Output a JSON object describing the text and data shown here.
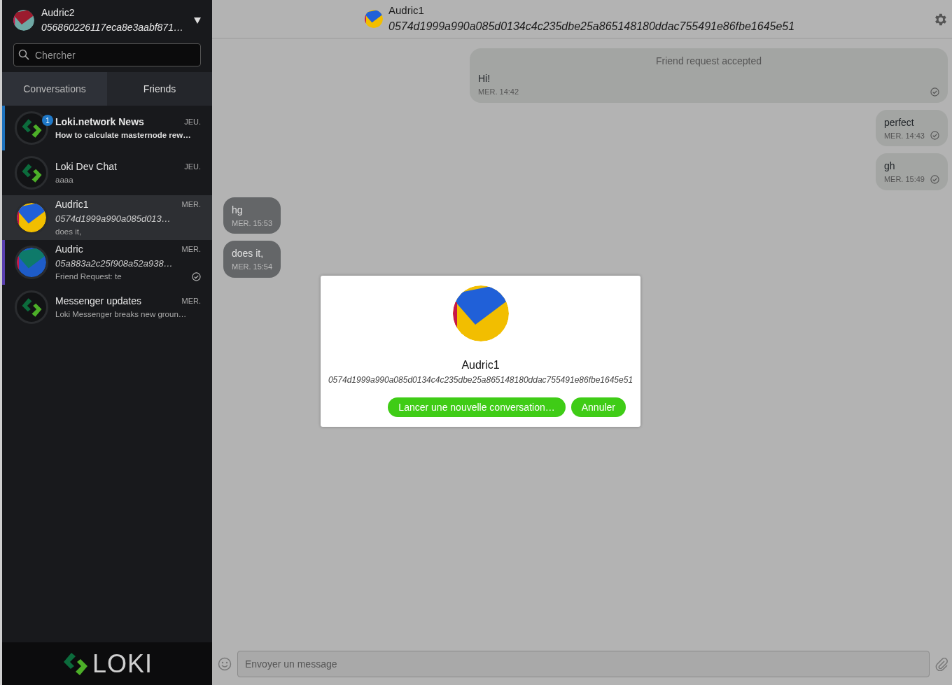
{
  "profile": {
    "name": "Audric2",
    "pubkey": "056860226117eca8e3aabf871…",
    "avatar": {
      "kind": "identicon"
    }
  },
  "search": {
    "placeholder": "Chercher"
  },
  "tabs": [
    {
      "label": "Conversations",
      "selected": true
    },
    {
      "label": "Friends",
      "selected": false
    }
  ],
  "conversations": [
    {
      "name": "Loki.network News",
      "preview": "How to calculate masternode rew…",
      "time": "JEU.",
      "unread": "1",
      "selected": false,
      "bold": true,
      "delivered": false,
      "avatar": {
        "kind": "logo"
      }
    },
    {
      "name": "Loki Dev Chat",
      "preview": "aaaa",
      "time": "JEU.",
      "selected": false,
      "bold": false,
      "delivered": false,
      "avatar": {
        "kind": "logo"
      }
    },
    {
      "name": "Audric1",
      "pubkey": "0574d1999a990a085d013…",
      "preview": "does it,",
      "time": "MER.",
      "selected": true,
      "bold": false,
      "delivered": false,
      "avatar": {
        "kind": "identicon"
      }
    },
    {
      "name": "Audric",
      "pubkey": "05a883a2c25f908a52a938…",
      "preview": "Friend Request: te",
      "time": "MER.",
      "selected": false,
      "pending_request": true,
      "bold": false,
      "delivered": true,
      "avatar": {
        "kind": "identicon"
      }
    },
    {
      "name": "Messenger updates",
      "preview": "Loki Messenger breaks new groun…",
      "time": "MER.",
      "selected": false,
      "bold": false,
      "delivered": false,
      "avatar": {
        "kind": "logo"
      }
    }
  ],
  "brand": "LOKI",
  "chat_header": {
    "name": "Audric1",
    "pubkey": "0574d1999a990a085d0134c4c235dbe25a865148180ddac755491e86fbe1645e51"
  },
  "messages": [
    {
      "kind": "system",
      "notice": "Friend request accepted",
      "text": "Hi!",
      "time": "MER. 14:42",
      "outgoing": true,
      "delivered": true
    },
    {
      "kind": "text",
      "text": "perfect",
      "time": "MER. 14:43",
      "outgoing": true,
      "delivered": true
    },
    {
      "kind": "text",
      "text": "gh",
      "time": "MER. 15:49",
      "outgoing": true,
      "delivered": true
    },
    {
      "kind": "text",
      "text": "hg",
      "time": "MER. 15:53",
      "outgoing": false,
      "delivered": false
    },
    {
      "kind": "text",
      "text": "does it,",
      "time": "MER. 15:54",
      "outgoing": false,
      "delivered": false
    }
  ],
  "composer": {
    "placeholder": "Envoyer un message"
  },
  "dialog": {
    "name": "Audric1",
    "pubkey": "0574d1999a990a085d0134c4c235dbe25a865148180ddac755491e86fbe1645e51",
    "buttons": [
      "Lancer une nouvelle conversation…",
      "Annuler"
    ]
  }
}
